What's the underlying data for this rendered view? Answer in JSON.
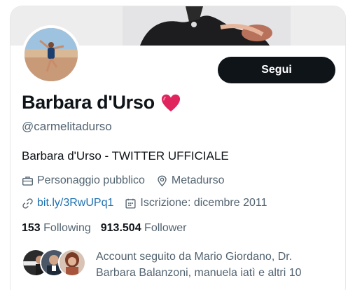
{
  "profile": {
    "name": "Barbara d'Urso",
    "handle": "@carmelitadurso",
    "bio": "Barbara d'Urso - TWITTER UFFICIALE",
    "category": "Personaggio pubblico",
    "location": "Metadurso",
    "link": "bit.ly/3RwUPq1",
    "joined": "Iscrizione: dicembre 2011"
  },
  "actions": {
    "follow_label": "Segui"
  },
  "stats": {
    "following_count": "153",
    "following_label": "Following",
    "followers_count": "913.504",
    "followers_label": "Follower"
  },
  "followed_by": {
    "text": "Account seguito da Mario Giordano, Dr. Barbara Balanzoni, manuela iatì e altri 10"
  },
  "icons": {
    "heart": "heart-icon",
    "category": "briefcase-icon",
    "location": "location-pin-icon",
    "link": "link-icon",
    "joined": "calendar-icon"
  },
  "colors": {
    "button_bg": "#0f1419",
    "secondary_text": "#536471",
    "link": "#1d6fb0",
    "heart": "#e0245e"
  }
}
